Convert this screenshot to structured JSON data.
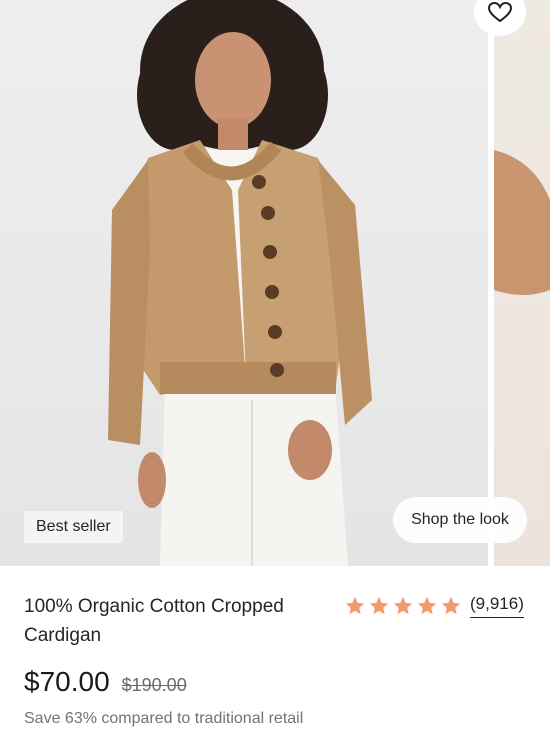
{
  "product": {
    "badge": "Best seller",
    "shop_the_look": "Shop the look",
    "title": "100% Organic Cotton Cropped Cardigan",
    "rating": {
      "stars": 5,
      "count_label": "(9,916)",
      "star_color": "#f29a6e"
    },
    "price": "$70.00",
    "original_price": "$190.00",
    "savings_text": "Save 63% compared to traditional retail"
  },
  "icons": {
    "favorite": "heart-icon",
    "rating_star": "star-icon"
  }
}
